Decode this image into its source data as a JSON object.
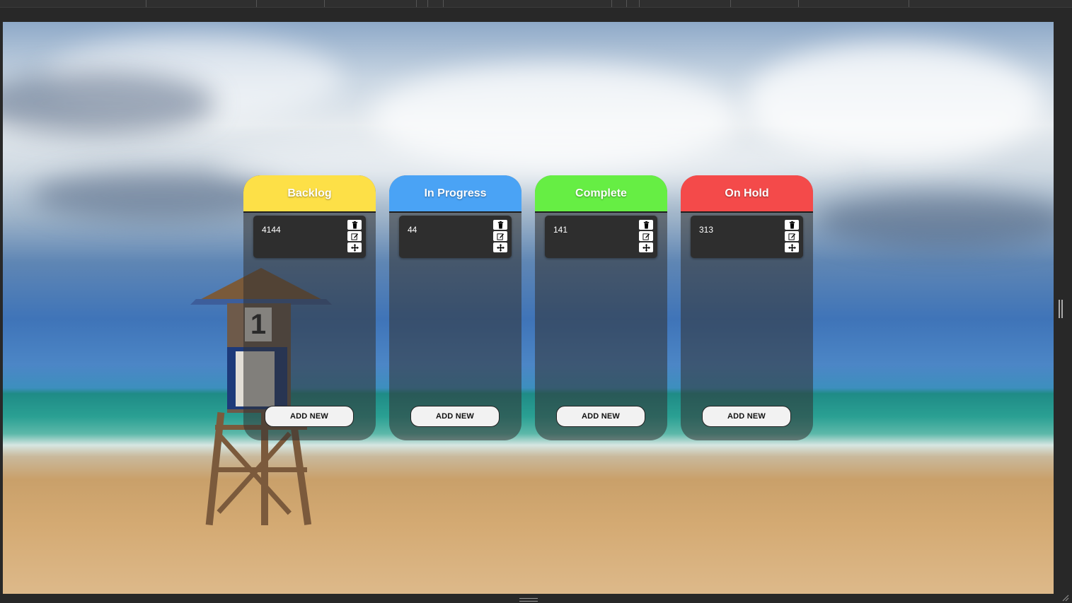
{
  "board": {
    "columns": [
      {
        "title": "Backlog",
        "color": "#fde047",
        "cards": [
          {
            "text": "4144"
          }
        ],
        "add_label": "ADD NEW"
      },
      {
        "title": "In Progress",
        "color": "#4aa3f5",
        "cards": [
          {
            "text": "44"
          }
        ],
        "add_label": "ADD NEW"
      },
      {
        "title": "Complete",
        "color": "#66ee44",
        "cards": [
          {
            "text": "141"
          }
        ],
        "add_label": "ADD NEW"
      },
      {
        "title": "On Hold",
        "color": "#f44a4a",
        "cards": [
          {
            "text": "313"
          }
        ],
        "add_label": "ADD NEW"
      }
    ]
  },
  "card_icons": [
    "trash-icon",
    "edit-icon",
    "move-icon"
  ],
  "background": {
    "scene": "beach-lifeguard-tower",
    "tower_number": "1"
  }
}
